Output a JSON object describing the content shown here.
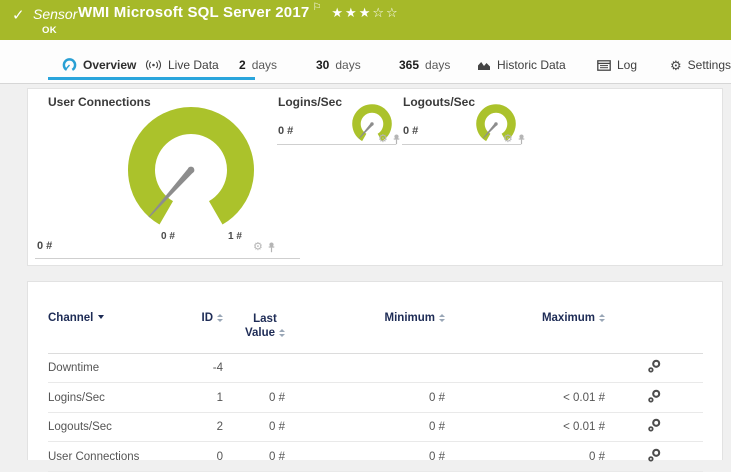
{
  "header": {
    "kind": "Sensor",
    "title": "WMI Microsoft SQL Server 2017",
    "status": "OK",
    "stars": "★★★☆☆",
    "stars_filled": 3,
    "stars_total": 5
  },
  "tabs": [
    {
      "label": "Overview",
      "icon": "gauge-icon",
      "active": true
    },
    {
      "label": "Live Data",
      "icon": "signal-icon"
    },
    {
      "num": "2",
      "unit": "days"
    },
    {
      "num": "30",
      "unit": "days"
    },
    {
      "num": "365",
      "unit": "days"
    },
    {
      "label": "Historic Data",
      "icon": "area-chart-icon"
    },
    {
      "label": "Log",
      "icon": "log-list-icon"
    },
    {
      "label": "Settings",
      "icon": "gear-icon"
    }
  ],
  "gauge_panel": {
    "primary": {
      "title": "User Connections",
      "value": "0 #",
      "scale_min_label": "0 #",
      "scale_max_label": "1 #",
      "actions": [
        "gear-icon",
        "pin-icon"
      ]
    },
    "small_gauges": [
      {
        "title": "Logins/Sec",
        "value": "0 #",
        "actions": [
          "gear-icon",
          "pin-icon"
        ]
      },
      {
        "title": "Logouts/Sec",
        "value": "0 #",
        "actions": [
          "gear-icon",
          "pin-icon"
        ]
      }
    ]
  },
  "table": {
    "columns": {
      "channel": "Channel",
      "id": "ID",
      "last_line1": "Last",
      "last_line2": "Value",
      "minimum": "Minimum",
      "maximum": "Maximum"
    },
    "sorted_by": "channel",
    "rows": [
      {
        "channel": "Downtime",
        "id": "-4",
        "last": "",
        "min": "",
        "max": ""
      },
      {
        "channel": "Logins/Sec",
        "id": "1",
        "last": "0 #",
        "min": "0 #",
        "max": "< 0.01 #"
      },
      {
        "channel": "Logouts/Sec",
        "id": "2",
        "last": "0 #",
        "min": "0 #",
        "max": "< 0.01 #"
      },
      {
        "channel": "User Connections",
        "id": "0",
        "last": "0 #",
        "min": "0 #",
        "max": "0 #"
      }
    ]
  },
  "colors": {
    "header_green": "#a6b929",
    "gauge_green": "#abc22b",
    "needle_gray": "#8d8d8d",
    "active_tab_blue": "#2aa5dc",
    "table_header_navy": "#1e2c56"
  }
}
